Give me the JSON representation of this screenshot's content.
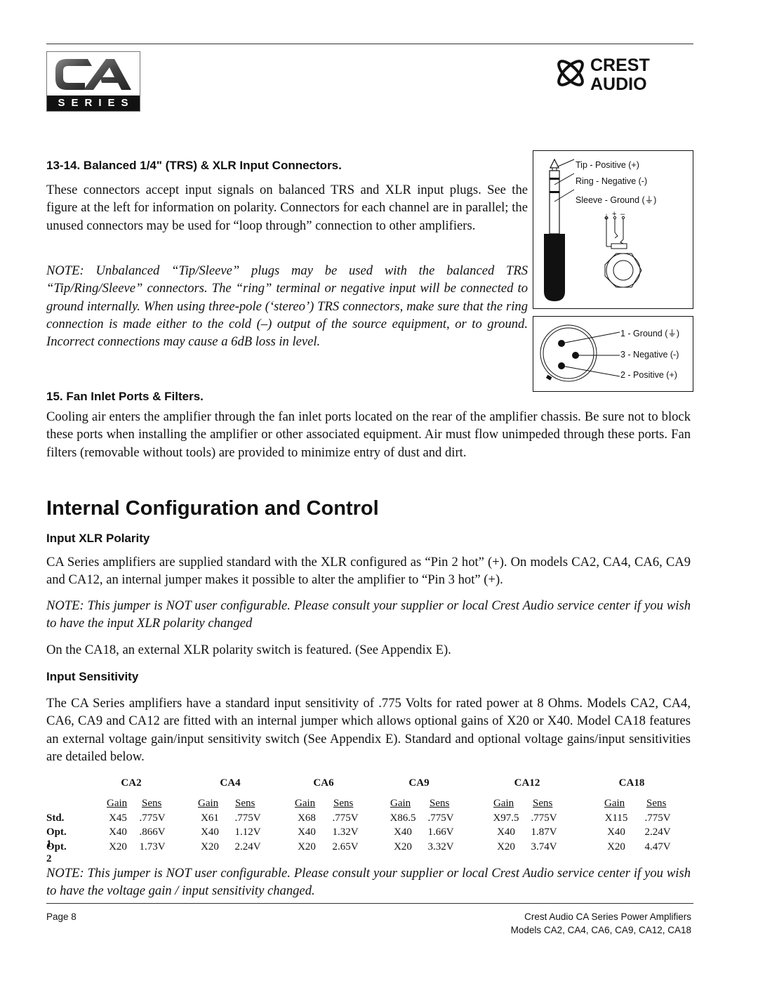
{
  "header": {
    "left_logo": {
      "letters": "CA",
      "banner": "SERIES"
    },
    "right_logo": {
      "line1": "CREST",
      "line2": "AUDIO"
    }
  },
  "section_connectors": {
    "heading": "13-14. Balanced 1/4\" (TRS) & XLR Input Connectors.",
    "body": "These connectors accept input signals on balanced TRS and XLR input plugs. See the figure at the left for information on polarity. Connectors for each channel are in parallel; the unused connectors may be used for “loop through” connection to other amplifiers.",
    "note": "NOTE: Unbalanced “Tip/Sleeve” plugs may be used with the balanced TRS “Tip/Ring/Sleeve” connectors. The “ring” terminal or negative input will be connected to ground internally. When using three-pole (‘stereo’) TRS connectors, make sure that the ring connection is made either to the cold (–) output of the source equipment, or to ground. Incorrect connections may cause a 6dB loss in level."
  },
  "trs_diagram": {
    "labels": [
      "Tip - Positive (+)",
      "Ring - Negative (-)",
      "Sleeve - Ground (⏚)"
    ],
    "jack_symbols": [
      "⏚",
      "+",
      "–"
    ]
  },
  "xlr_diagram": {
    "labels": [
      "1 - Ground (⏚)",
      "3 - Negative (-)",
      "2 - Positive (+)"
    ]
  },
  "section_fan": {
    "heading": "15. Fan Inlet Ports & Filters.",
    "body": "Cooling air enters the amplifier through the fan inlet ports located on the rear of the amplifier chassis. Be sure not to block these ports when installing the amplifier or other associated equipment. Air must flow unimpeded through these ports. Fan filters (removable without tools) are provided to minimize entry of dust and dirt."
  },
  "section_internal": {
    "title": "Internal Configuration and Control",
    "xlr_polarity": {
      "heading": "Input XLR Polarity",
      "body": "CA Series amplifiers are supplied standard with the XLR configured as “Pin 2 hot” (+). On models CA2, CA4, CA6, CA9 and CA12, an internal jumper makes it possible to alter the amplifier to “Pin 3 hot” (+).",
      "note": "NOTE: This jumper is NOT user configurable. Please consult your supplier or local Crest Audio service center if you wish to have the input XLR polarity changed",
      "body2": "On the CA18, an external XLR polarity switch is featured. (See Appendix E)."
    },
    "input_sensitivity": {
      "heading": "Input Sensitivity",
      "body": "The CA Series amplifiers have a standard input sensitivity of .775 Volts for rated power at 8 Ohms. Models CA2, CA4, CA6, CA9 and CA12 are fitted with an internal jumper which allows optional gains of X20 or X40. Model CA18 features an external voltage gain/input sensitivity switch (See Appendix E). Standard and optional voltage gains/input sensitivities are detailed below.",
      "note": "NOTE: This jumper is NOT user configurable. Please consult your supplier or local Crest Audio service center if you wish to have the voltage gain / input sensitivity changed."
    }
  },
  "sensitivity_table": {
    "col_headers": [
      "Gain",
      "Sens"
    ],
    "row_labels": [
      "Std.",
      "Opt. 1",
      "Opt. 2"
    ],
    "models": [
      {
        "name": "CA2",
        "rows": [
          [
            "X45",
            ".775V"
          ],
          [
            "X40",
            ".866V"
          ],
          [
            "X20",
            "1.73V"
          ]
        ]
      },
      {
        "name": "CA4",
        "rows": [
          [
            "X61",
            ".775V"
          ],
          [
            "X40",
            "1.12V"
          ],
          [
            "X20",
            "2.24V"
          ]
        ]
      },
      {
        "name": "CA6",
        "rows": [
          [
            "X68",
            ".775V"
          ],
          [
            "X40",
            "1.32V"
          ],
          [
            "X20",
            "2.65V"
          ]
        ]
      },
      {
        "name": "CA9",
        "rows": [
          [
            "X86.5",
            ".775V"
          ],
          [
            "X40",
            "1.66V"
          ],
          [
            "X20",
            "3.32V"
          ]
        ]
      },
      {
        "name": "CA12",
        "rows": [
          [
            "X97.5",
            ".775V"
          ],
          [
            "X40",
            "1.87V"
          ],
          [
            "X20",
            "3.74V"
          ]
        ]
      },
      {
        "name": "CA18",
        "rows": [
          [
            "X115",
            ".775V"
          ],
          [
            "X40",
            "2.24V"
          ],
          [
            "X20",
            "4.47V"
          ]
        ]
      }
    ]
  },
  "footer": {
    "page": "Page 8",
    "title_line1": "Crest Audio CA Series Power Amplifiers",
    "title_line2": "Models CA2, CA4, CA6, CA9, CA12, CA18"
  }
}
